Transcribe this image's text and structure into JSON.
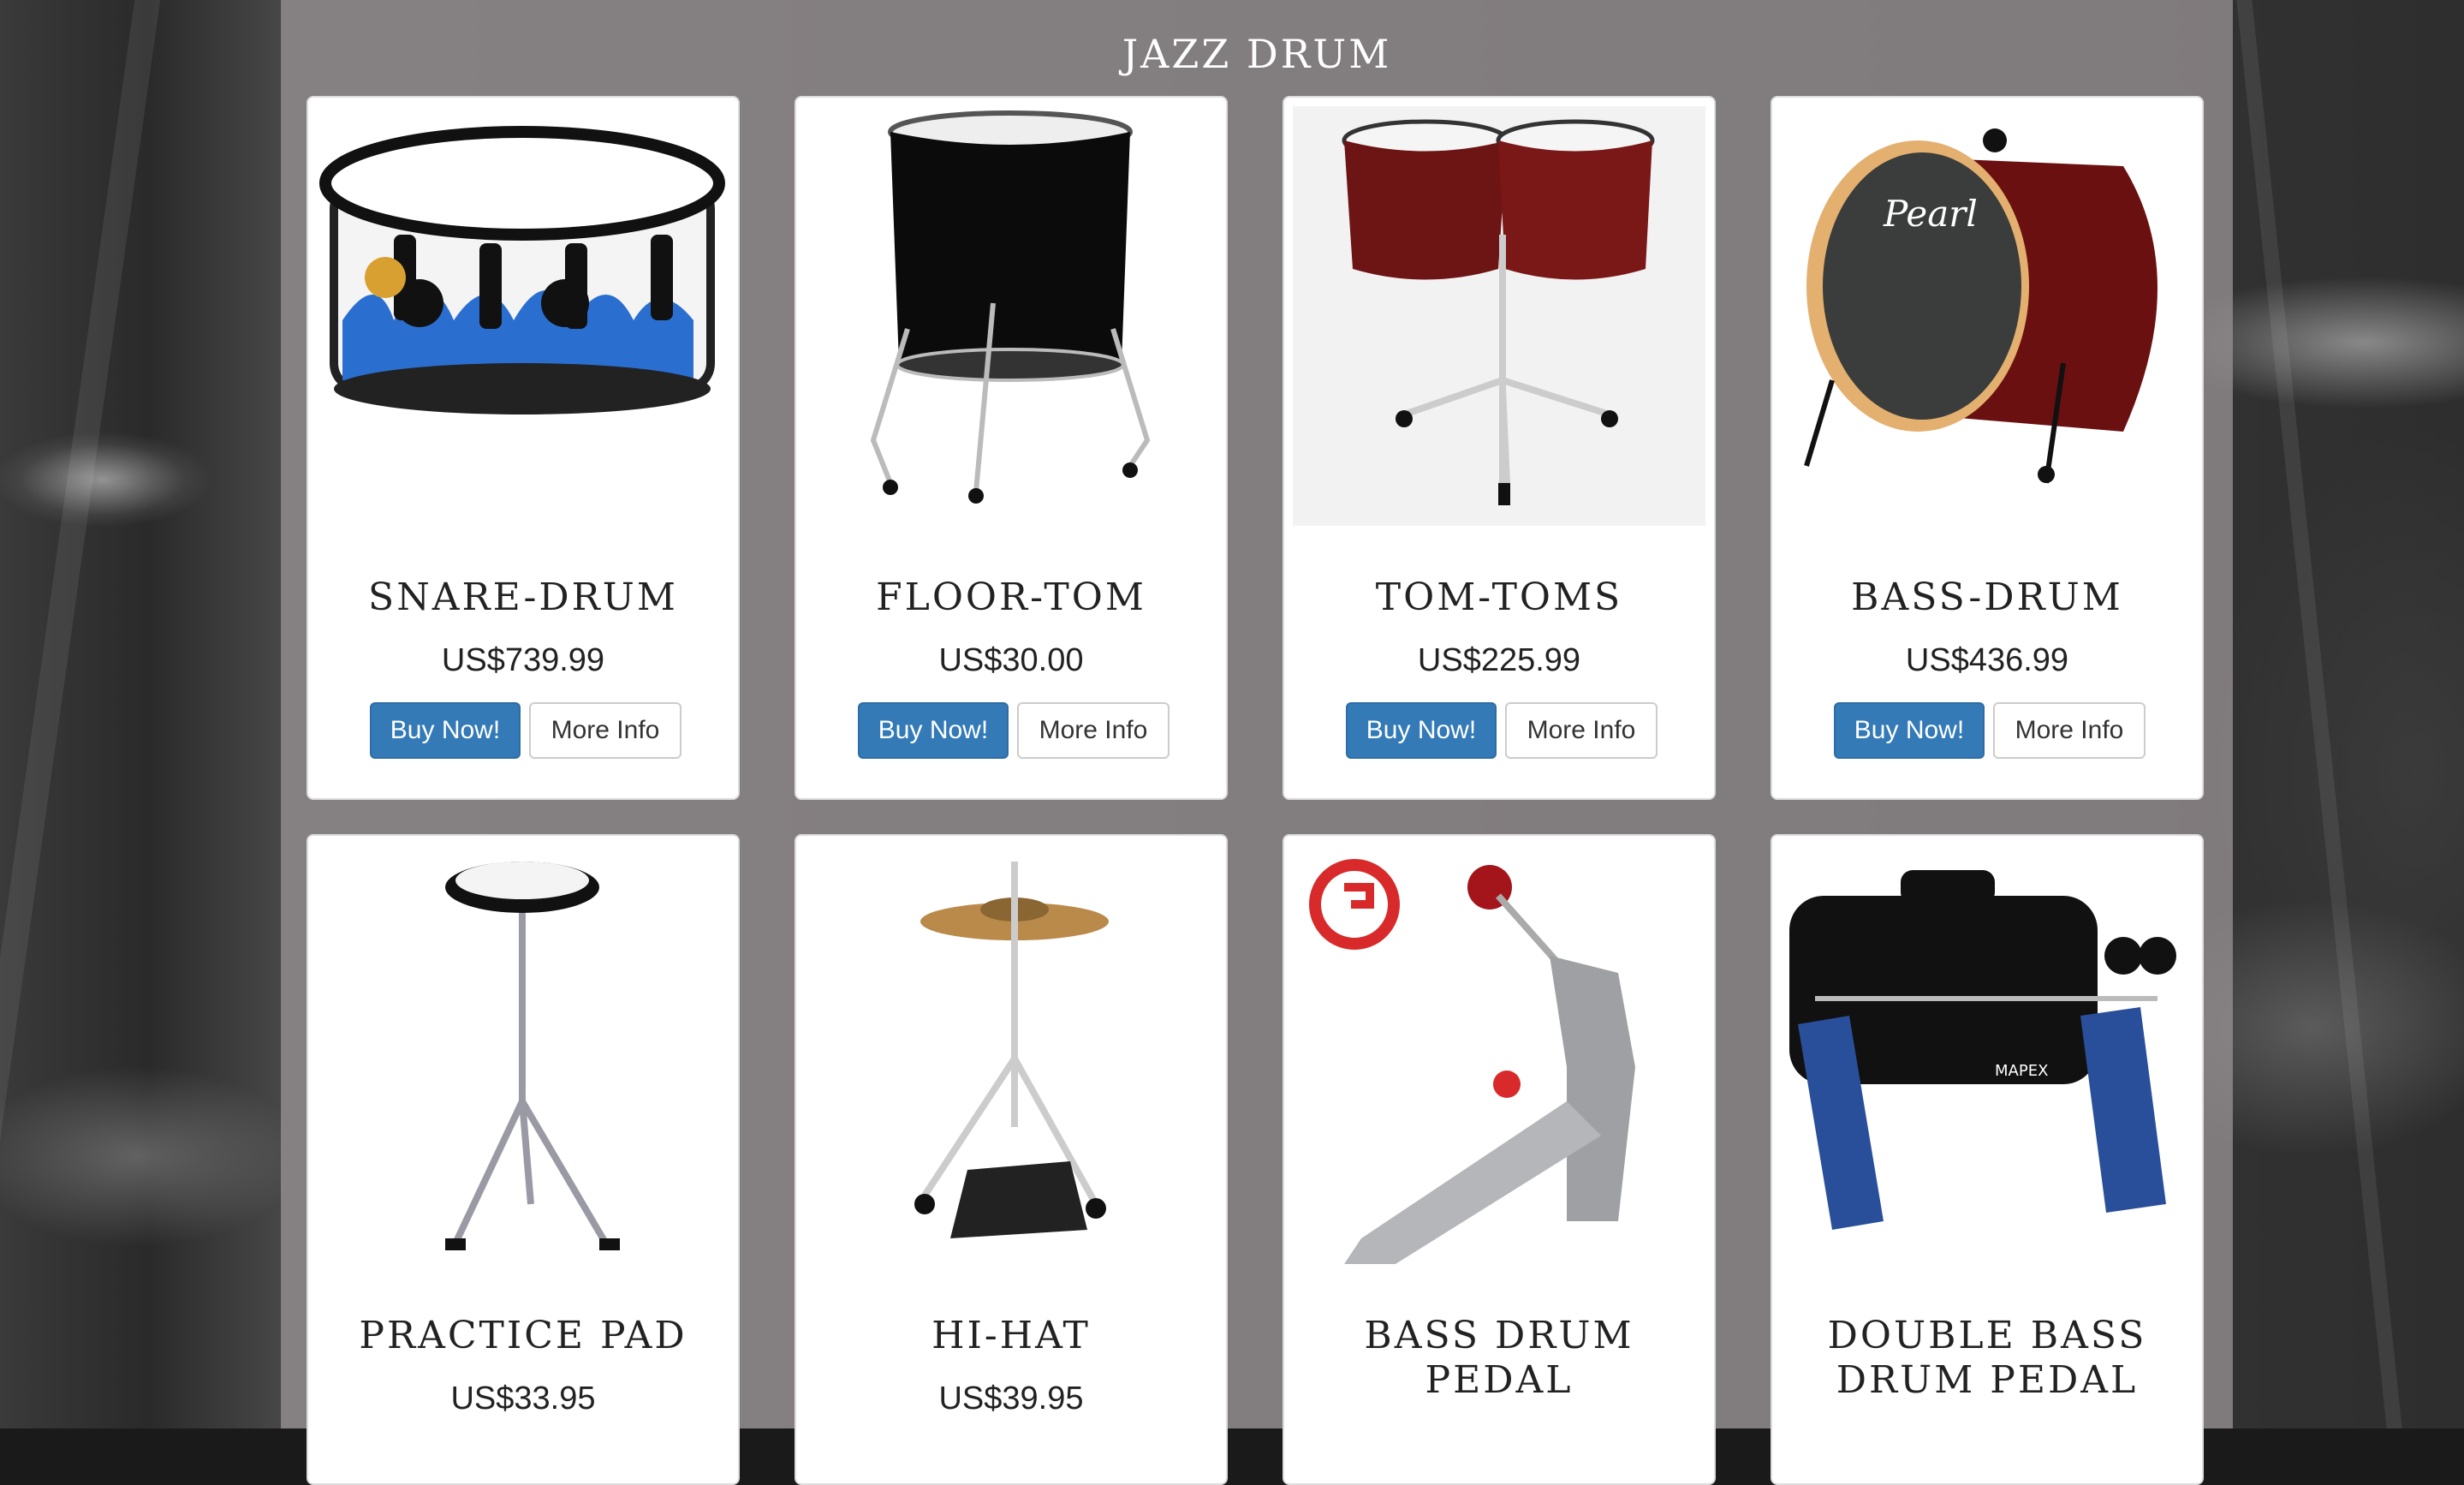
{
  "page": {
    "title": "JAZZ DRUM"
  },
  "buttons": {
    "buy": "Buy Now!",
    "info": "More Info"
  },
  "products": [
    {
      "name": "SNARE-DRUM",
      "price": "US$739.99",
      "icon": "snare-drum"
    },
    {
      "name": "FLOOR-TOM",
      "price": "US$30.00",
      "icon": "floor-tom"
    },
    {
      "name": "TOM-TOMS",
      "price": "US$225.99",
      "icon": "tom-toms"
    },
    {
      "name": "BASS-DRUM",
      "price": "US$436.99",
      "icon": "bass-drum"
    },
    {
      "name": "PRACTICE PAD",
      "price": "US$33.95",
      "icon": "practice-pad"
    },
    {
      "name": "HI-HAT",
      "price": "US$39.95",
      "icon": "hi-hat"
    },
    {
      "name": "BASS DRUM PEDAL",
      "price": "",
      "icon": "bass-drum-pedal"
    },
    {
      "name": "DOUBLE BASS DRUM PEDAL",
      "price": "",
      "icon": "double-bass-drum-pedal"
    }
  ]
}
